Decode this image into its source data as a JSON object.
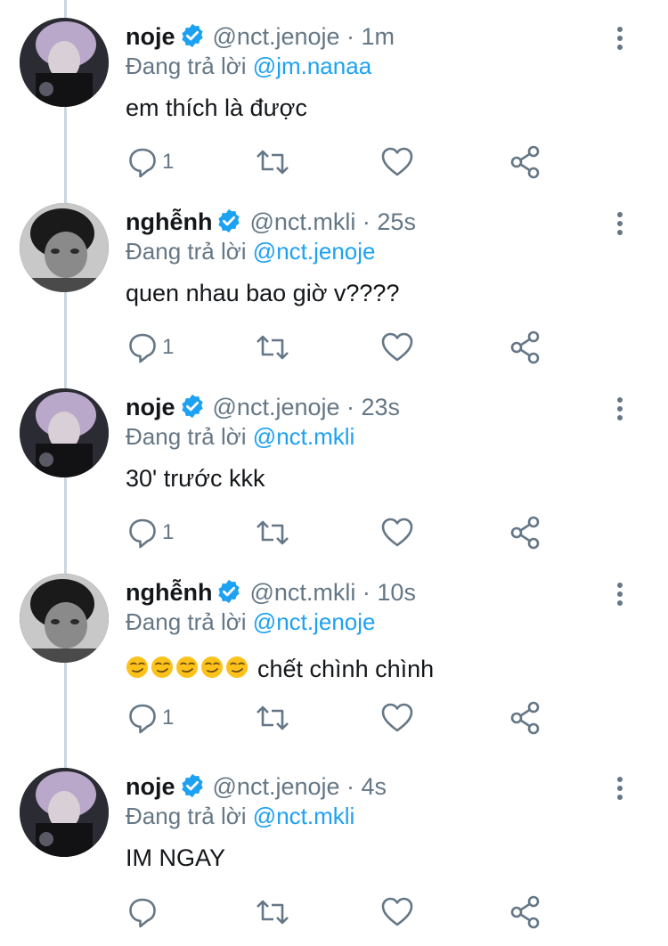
{
  "colors": {
    "text": "#14171a",
    "muted": "#657786",
    "link": "#1da1f2",
    "thread_line": "#ccd6dd"
  },
  "labels": {
    "replying_prefix": "Đang trả lời"
  },
  "tweets": [
    {
      "display_name": "noje",
      "handle": "@nct.jenoje",
      "time": "1m",
      "reply_to": "@jm.nanaa",
      "text": "em thích là được",
      "reply_count": "1",
      "avatar": "noje-avatar",
      "verified": true
    },
    {
      "display_name": "nghễnh",
      "handle": "@nct.mkli",
      "time": "25s",
      "reply_to": "@nct.jenoje",
      "text": "quen nhau bao giờ v????",
      "reply_count": "1",
      "avatar": "nghenh-avatar",
      "verified": true
    },
    {
      "display_name": "noje",
      "handle": "@nct.jenoje",
      "time": "23s",
      "reply_to": "@nct.mkli",
      "text": "30' trước kkk",
      "reply_count": "1",
      "avatar": "noje-avatar",
      "verified": true
    },
    {
      "display_name": "nghễnh",
      "handle": "@nct.mkli",
      "time": "10s",
      "reply_to": "@nct.jenoje",
      "emoji": "😏😏😏😏😏",
      "text": "chết chình chình",
      "reply_count": "1",
      "avatar": "nghenh-avatar",
      "verified": true
    },
    {
      "display_name": "noje",
      "handle": "@nct.jenoje",
      "time": "4s",
      "reply_to": "@nct.mkli",
      "text": "IM NGAY",
      "reply_count": "",
      "avatar": "noje-avatar",
      "verified": true
    }
  ],
  "icons": {
    "more": "more-vertical-icon",
    "reply": "reply-icon",
    "retweet": "retweet-icon",
    "like": "heart-icon",
    "share": "share-icon",
    "verified": "verified-badge-icon",
    "smirk": "smirk-emoji-icon"
  }
}
